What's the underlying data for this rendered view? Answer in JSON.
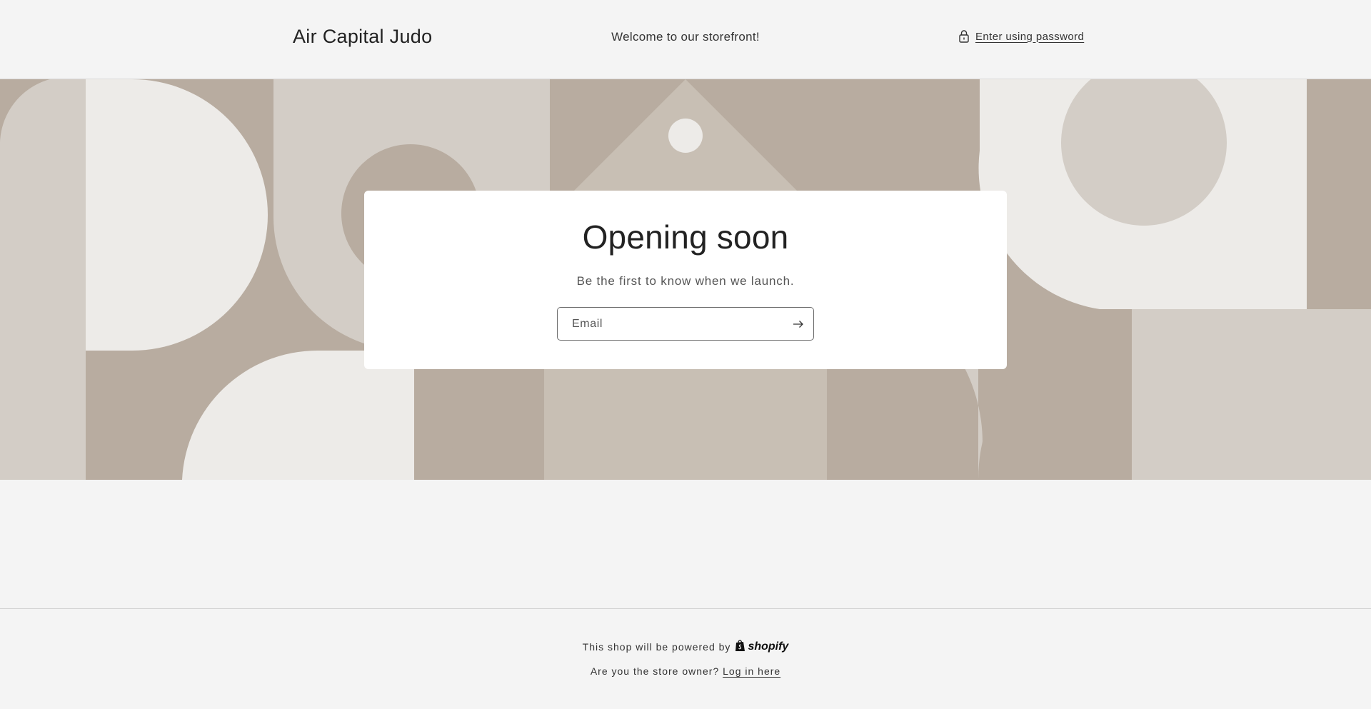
{
  "header": {
    "brand": "Air Capital Judo",
    "welcome": "Welcome to our storefront!",
    "password_link": "Enter using password",
    "password_icon": "lock-icon"
  },
  "card": {
    "title": "Opening soon",
    "subtitle": "Be the first to know when we launch.",
    "email_placeholder": "Email",
    "email_value": "",
    "submit_icon": "arrow-right-icon"
  },
  "footer": {
    "powered_text": "This shop will be powered by",
    "shopify_label": "shopify",
    "owner_text": "Are you the store owner?",
    "login_link": "Log in here"
  },
  "colors": {
    "page_bg": "#f4f4f4",
    "banner_dark": "#b8aca0",
    "banner_mid": "#c8bfb4",
    "banner_light": "#d3cdc6",
    "banner_lightest": "#edebe8",
    "card_bg": "#ffffff"
  }
}
